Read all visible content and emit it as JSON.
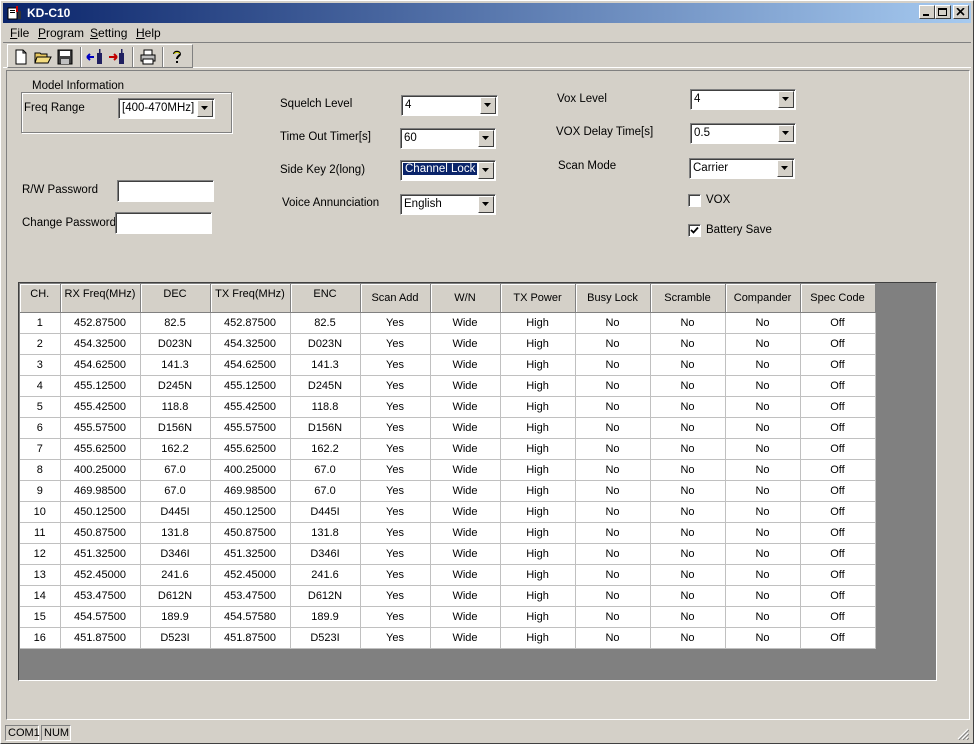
{
  "window": {
    "title": "KD-C10"
  },
  "menu": [
    "File",
    "Program",
    "Setting",
    "Help"
  ],
  "toolbar": [
    "new-icon",
    "open-icon",
    "save-icon",
    "read-radio-icon",
    "write-radio-icon",
    "print-icon",
    "help-icon"
  ],
  "model_info": {
    "group_title": "Model Information",
    "freq_range_label": "Freq Range",
    "freq_range_value": "[400-470MHz]"
  },
  "passwords": {
    "rw_label": "R/W Password",
    "rw_value": "",
    "change_label": "Change Password",
    "change_value": ""
  },
  "settings_mid": {
    "squelch_label": "Squelch Level",
    "squelch_value": "4",
    "timeout_label": "Time Out Timer[s]",
    "timeout_value": "60",
    "sidekey_label": "Side Key 2(long)",
    "sidekey_value": "Channel Lock",
    "voice_label": "Voice Annunciation",
    "voice_value": "English"
  },
  "settings_right": {
    "vox_level_label": "Vox Level",
    "vox_level_value": "4",
    "vox_delay_label": "VOX Delay Time[s]",
    "vox_delay_value": "0.5",
    "scan_mode_label": "Scan Mode",
    "scan_mode_value": "Carrier",
    "vox_check_label": "VOX",
    "vox_checked": false,
    "battery_label": "Battery Save",
    "battery_checked": true
  },
  "table": {
    "columns": [
      "CH.",
      "RX Freq(MHz)",
      "DEC",
      "TX Freq(MHz)",
      "ENC",
      "Scan Add",
      "W/N",
      "TX Power",
      "Busy Lock",
      "Scramble",
      "Compander",
      "Spec Code"
    ],
    "rows": [
      [
        "1",
        "452.87500",
        "82.5",
        "452.87500",
        "82.5",
        "Yes",
        "Wide",
        "High",
        "No",
        "No",
        "No",
        "Off"
      ],
      [
        "2",
        "454.32500",
        "D023N",
        "454.32500",
        "D023N",
        "Yes",
        "Wide",
        "High",
        "No",
        "No",
        "No",
        "Off"
      ],
      [
        "3",
        "454.62500",
        "141.3",
        "454.62500",
        "141.3",
        "Yes",
        "Wide",
        "High",
        "No",
        "No",
        "No",
        "Off"
      ],
      [
        "4",
        "455.12500",
        "D245N",
        "455.12500",
        "D245N",
        "Yes",
        "Wide",
        "High",
        "No",
        "No",
        "No",
        "Off"
      ],
      [
        "5",
        "455.42500",
        "118.8",
        "455.42500",
        "118.8",
        "Yes",
        "Wide",
        "High",
        "No",
        "No",
        "No",
        "Off"
      ],
      [
        "6",
        "455.57500",
        "D156N",
        "455.57500",
        "D156N",
        "Yes",
        "Wide",
        "High",
        "No",
        "No",
        "No",
        "Off"
      ],
      [
        "7",
        "455.62500",
        "162.2",
        "455.62500",
        "162.2",
        "Yes",
        "Wide",
        "High",
        "No",
        "No",
        "No",
        "Off"
      ],
      [
        "8",
        "400.25000",
        "67.0",
        "400.25000",
        "67.0",
        "Yes",
        "Wide",
        "High",
        "No",
        "No",
        "No",
        "Off"
      ],
      [
        "9",
        "469.98500",
        "67.0",
        "469.98500",
        "67.0",
        "Yes",
        "Wide",
        "High",
        "No",
        "No",
        "No",
        "Off"
      ],
      [
        "10",
        "450.12500",
        "D445I",
        "450.12500",
        "D445I",
        "Yes",
        "Wide",
        "High",
        "No",
        "No",
        "No",
        "Off"
      ],
      [
        "11",
        "450.87500",
        "131.8",
        "450.87500",
        "131.8",
        "Yes",
        "Wide",
        "High",
        "No",
        "No",
        "No",
        "Off"
      ],
      [
        "12",
        "451.32500",
        "D346I",
        "451.32500",
        "D346I",
        "Yes",
        "Wide",
        "High",
        "No",
        "No",
        "No",
        "Off"
      ],
      [
        "13",
        "452.45000",
        "241.6",
        "452.45000",
        "241.6",
        "Yes",
        "Wide",
        "High",
        "No",
        "No",
        "No",
        "Off"
      ],
      [
        "14",
        "453.47500",
        "D612N",
        "453.47500",
        "D612N",
        "Yes",
        "Wide",
        "High",
        "No",
        "No",
        "No",
        "Off"
      ],
      [
        "15",
        "454.57500",
        "189.9",
        "454.57580",
        "189.9",
        "Yes",
        "Wide",
        "High",
        "No",
        "No",
        "No",
        "Off"
      ],
      [
        "16",
        "451.87500",
        "D523I",
        "451.87500",
        "D523I",
        "Yes",
        "Wide",
        "High",
        "No",
        "No",
        "No",
        "Off"
      ]
    ]
  },
  "status": {
    "port": "COM1",
    "numlock": "NUM"
  }
}
